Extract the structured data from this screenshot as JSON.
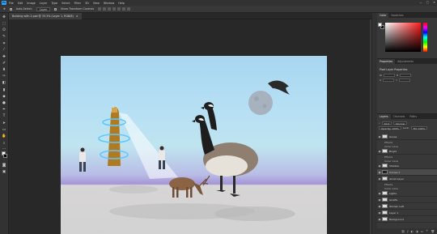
{
  "menu": {
    "logo": "Ps",
    "items": [
      "File",
      "Edit",
      "Image",
      "Layer",
      "Type",
      "Select",
      "Filter",
      "3D",
      "View",
      "Window",
      "Help"
    ],
    "window_controls": [
      "—",
      "□",
      "✕"
    ]
  },
  "options": {
    "auto_select_label": "Auto-Select:",
    "auto_select_value": "Layer",
    "transform_label": "Show Transform Controls"
  },
  "document": {
    "tab_title": "Building with 2.psd @ 33.3% (Layer 1, RGB/8)",
    "close_symbol": "×"
  },
  "panels": {
    "color_tabs": [
      "Color",
      "Swatches"
    ],
    "props_tabs": [
      "Properties",
      "Adjustments"
    ],
    "props_title": "Pixel Layer Properties",
    "props_fields": [
      "W",
      "H",
      "X",
      "Y"
    ],
    "layers_tabs": [
      "Layers",
      "Channels",
      "Paths"
    ],
    "kind_label": "Kind",
    "mode_label": "Normal",
    "opacity_label": "Opacity: 100%",
    "lock_label": "Lock:",
    "fill_label": "Fill: 100%",
    "footer_icons": [
      "link-icon",
      "fx-icon",
      "mask-icon",
      "adjustment-icon",
      "folder-icon",
      "new-layer-icon",
      "trash-icon"
    ]
  },
  "layers": [
    {
      "name": "Goose",
      "type": "group"
    },
    {
      "name": "Effects",
      "type": "sub"
    },
    {
      "name": "Outer Glow",
      "type": "sub"
    },
    {
      "name": "Bright",
      "type": "layer"
    },
    {
      "name": "Effects",
      "type": "sub"
    },
    {
      "name": "Outer Glow",
      "type": "sub"
    },
    {
      "name": "Shadow",
      "type": "layer"
    },
    {
      "name": "Curves 1",
      "type": "layer",
      "active": true
    },
    {
      "name": "Ghost Layer",
      "type": "layer"
    },
    {
      "name": "Effects",
      "type": "sub"
    },
    {
      "name": "Outer Glow",
      "type": "sub"
    },
    {
      "name": "Lights",
      "type": "layer"
    },
    {
      "name": "Giraffe",
      "type": "layer"
    },
    {
      "name": "Woman Left",
      "type": "layer"
    },
    {
      "name": "Layer 1",
      "type": "layer"
    },
    {
      "name": "Background",
      "type": "layer"
    }
  ],
  "colors": {
    "accent": "#31a8ff",
    "sky_top": "#a7d6f1",
    "horizon": "#a594d6",
    "ground": "#d2d2d2"
  }
}
